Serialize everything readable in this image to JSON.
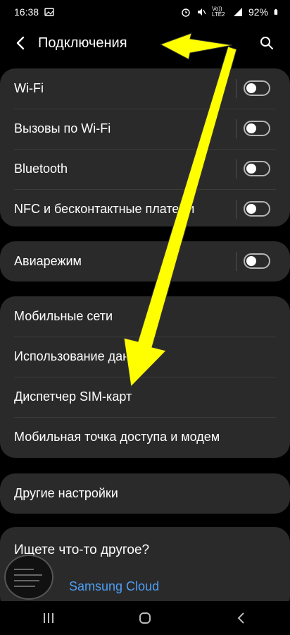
{
  "status_bar": {
    "time": "16:38",
    "network": "Vo)) LTE2",
    "battery": "92%"
  },
  "header": {
    "title": "Подключения"
  },
  "groups": {
    "wireless": [
      {
        "label": "Wi-Fi",
        "toggle_on": false
      },
      {
        "label": "Вызовы по Wi-Fi",
        "toggle_on": false
      },
      {
        "label": "Bluetooth",
        "toggle_on": false
      },
      {
        "label": "NFC и бесконтактные платежи",
        "toggle_on": false
      }
    ],
    "airplane": {
      "label": "Авиарежим",
      "toggle_on": false
    },
    "mobile": [
      {
        "label": "Мобильные сети"
      },
      {
        "label": "Использование данных"
      },
      {
        "label": "Диспетчер SIM-карт"
      },
      {
        "label": "Мобильная точка доступа и модем"
      }
    ],
    "other": {
      "label": "Другие настройки"
    }
  },
  "search_suggest": {
    "title": "Ищете что-то другое?",
    "link": "Samsung Cloud"
  },
  "icons": {
    "back": "chevron-left-icon",
    "search": "search-icon",
    "nav_recents": "recents-icon",
    "nav_home": "home-icon",
    "nav_back": "back-icon"
  },
  "colors": {
    "background": "#000000",
    "card": "#2a2a2a",
    "link": "#4d9ff6",
    "annotation_arrow": "#ffff00"
  }
}
